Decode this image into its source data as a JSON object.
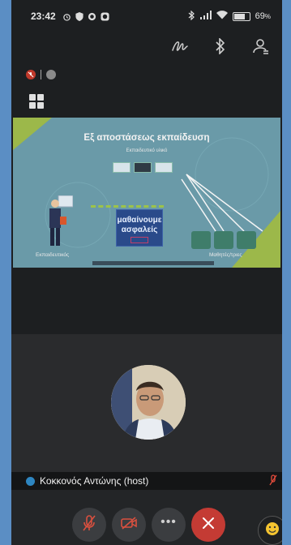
{
  "status_bar": {
    "time": "23:42",
    "battery_percent": "69",
    "battery_unit": "%",
    "battery_level": 0.69
  },
  "slide": {
    "title": "Εξ αποστάσεως εκπαίδευση",
    "subtitle": "Εκπαιδευτικό υλικό",
    "center_text_line1": "μαθαίνουμε",
    "center_text_line2": "ασφαλείς",
    "teacher_label": "Εκπαιδευτικός",
    "students_label": "Μαθητές/τριες",
    "colors": {
      "background": "#6a9aa8",
      "accent": "#9cb84a",
      "center_box": "#2a4a8a"
    }
  },
  "participant": {
    "name": "Κοκκονός Αντώνης (host)"
  },
  "icons": {
    "status": [
      "alarm-icon",
      "shield-icon",
      "circle-icon",
      "app-icon"
    ],
    "status_right": [
      "bluetooth-icon",
      "signal-icon",
      "wifi-icon",
      "battery-icon"
    ],
    "toolbar": [
      "annotate-icon",
      "bluetooth-icon",
      "participants-icon"
    ],
    "controls": [
      "mic-off-icon",
      "camera-off-icon",
      "more-icon",
      "leave-icon",
      "reaction-icon"
    ]
  },
  "colors": {
    "leave_red": "#c43b34",
    "mute_red": "#c0392b"
  }
}
